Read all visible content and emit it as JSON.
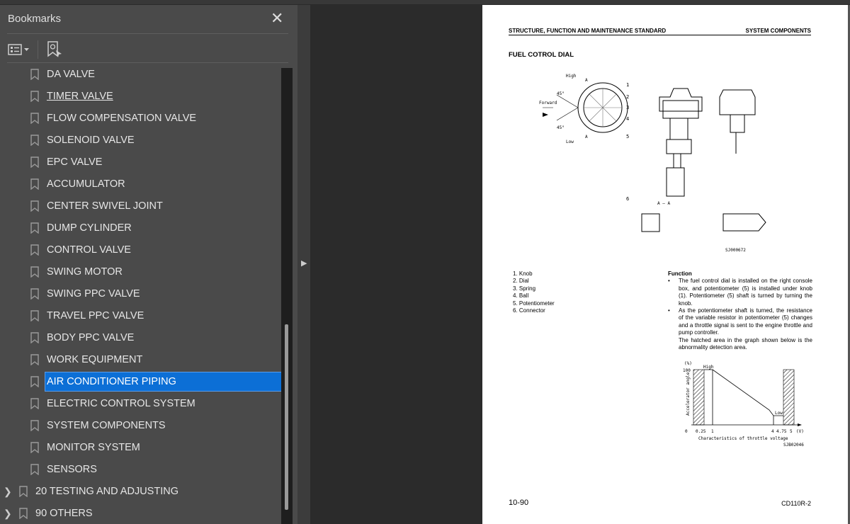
{
  "panel": {
    "title": "Bookmarks",
    "close": "✕"
  },
  "bookmarks": [
    {
      "label": "DA VALVE"
    },
    {
      "label": "TIMER VALVE",
      "hover": true
    },
    {
      "label": "FLOW COMPENSATION VALVE"
    },
    {
      "label": "SOLENOID VALVE"
    },
    {
      "label": "EPC VALVE"
    },
    {
      "label": "ACCUMULATOR"
    },
    {
      "label": "CENTER SWIVEL JOINT"
    },
    {
      "label": "DUMP CYLINDER"
    },
    {
      "label": "CONTROL VALVE"
    },
    {
      "label": "SWING MOTOR"
    },
    {
      "label": "SWING PPC VALVE"
    },
    {
      "label": "TRAVEL PPC VALVE"
    },
    {
      "label": "BODY PPC VALVE"
    },
    {
      "label": "WORK EQUIPMENT"
    },
    {
      "label": "AIR CONDITIONER PIPING",
      "selected": true
    },
    {
      "label": "ELECTRIC CONTROL SYSTEM"
    },
    {
      "label": "SYSTEM COMPONENTS"
    },
    {
      "label": "MONITOR SYSTEM"
    },
    {
      "label": "SENSORS"
    }
  ],
  "top_level": [
    {
      "label": "20 TESTING AND ADJUSTING"
    },
    {
      "label": "90 OTHERS"
    }
  ],
  "colors": {
    "selection": "#0c6fd6",
    "panel": "#4a4a4a",
    "canvas": "#2b2b2b"
  },
  "page": {
    "header_left": "STRUCTURE, FUNCTION AND MAINTENANCE STANDARD",
    "header_right": "SYSTEM COMPONENTS",
    "title": "FUEL COTROL DIAL",
    "diagram": {
      "high": "High",
      "low": "Low",
      "forward": "Forward",
      "angle": "45°",
      "section": "A",
      "section_label": "A – A",
      "callouts": [
        "1",
        "2",
        "3",
        "4",
        "5",
        "6"
      ],
      "code": "SJ000672"
    },
    "parts": [
      "1. Knob",
      "2. Dial",
      "3. Spring",
      "4. Ball",
      "5. Potentiometer",
      "6. Connector"
    ],
    "function_title": "Function",
    "function_items": [
      "The fuel control dial is installed on the right console box, and potentiometer (5) is installed under knob (1).  Potentiometer (5) shaft is turned by turning the knob.",
      "As the potentiometer shaft is turned, the resistance of the variable resistor in potentiometer (5) changes and a throttle signal is sent to the engine throttle and pump controller."
    ],
    "function_note": "The hatched area in the graph shown below is the abnormality detection area.",
    "graph": {
      "y_unit": "(%)",
      "y_tick": "100",
      "ylabel": "Accelerator angle",
      "x_ticks": [
        "0",
        "0.25",
        "1",
        "4",
        "4.75",
        "5",
        "(V)"
      ],
      "xlabel": "Characteristics of throttle voltage",
      "high": "High",
      "low": "Low",
      "code": "SJB02046"
    },
    "page_number": "10-90",
    "model": "CD110R-2"
  }
}
